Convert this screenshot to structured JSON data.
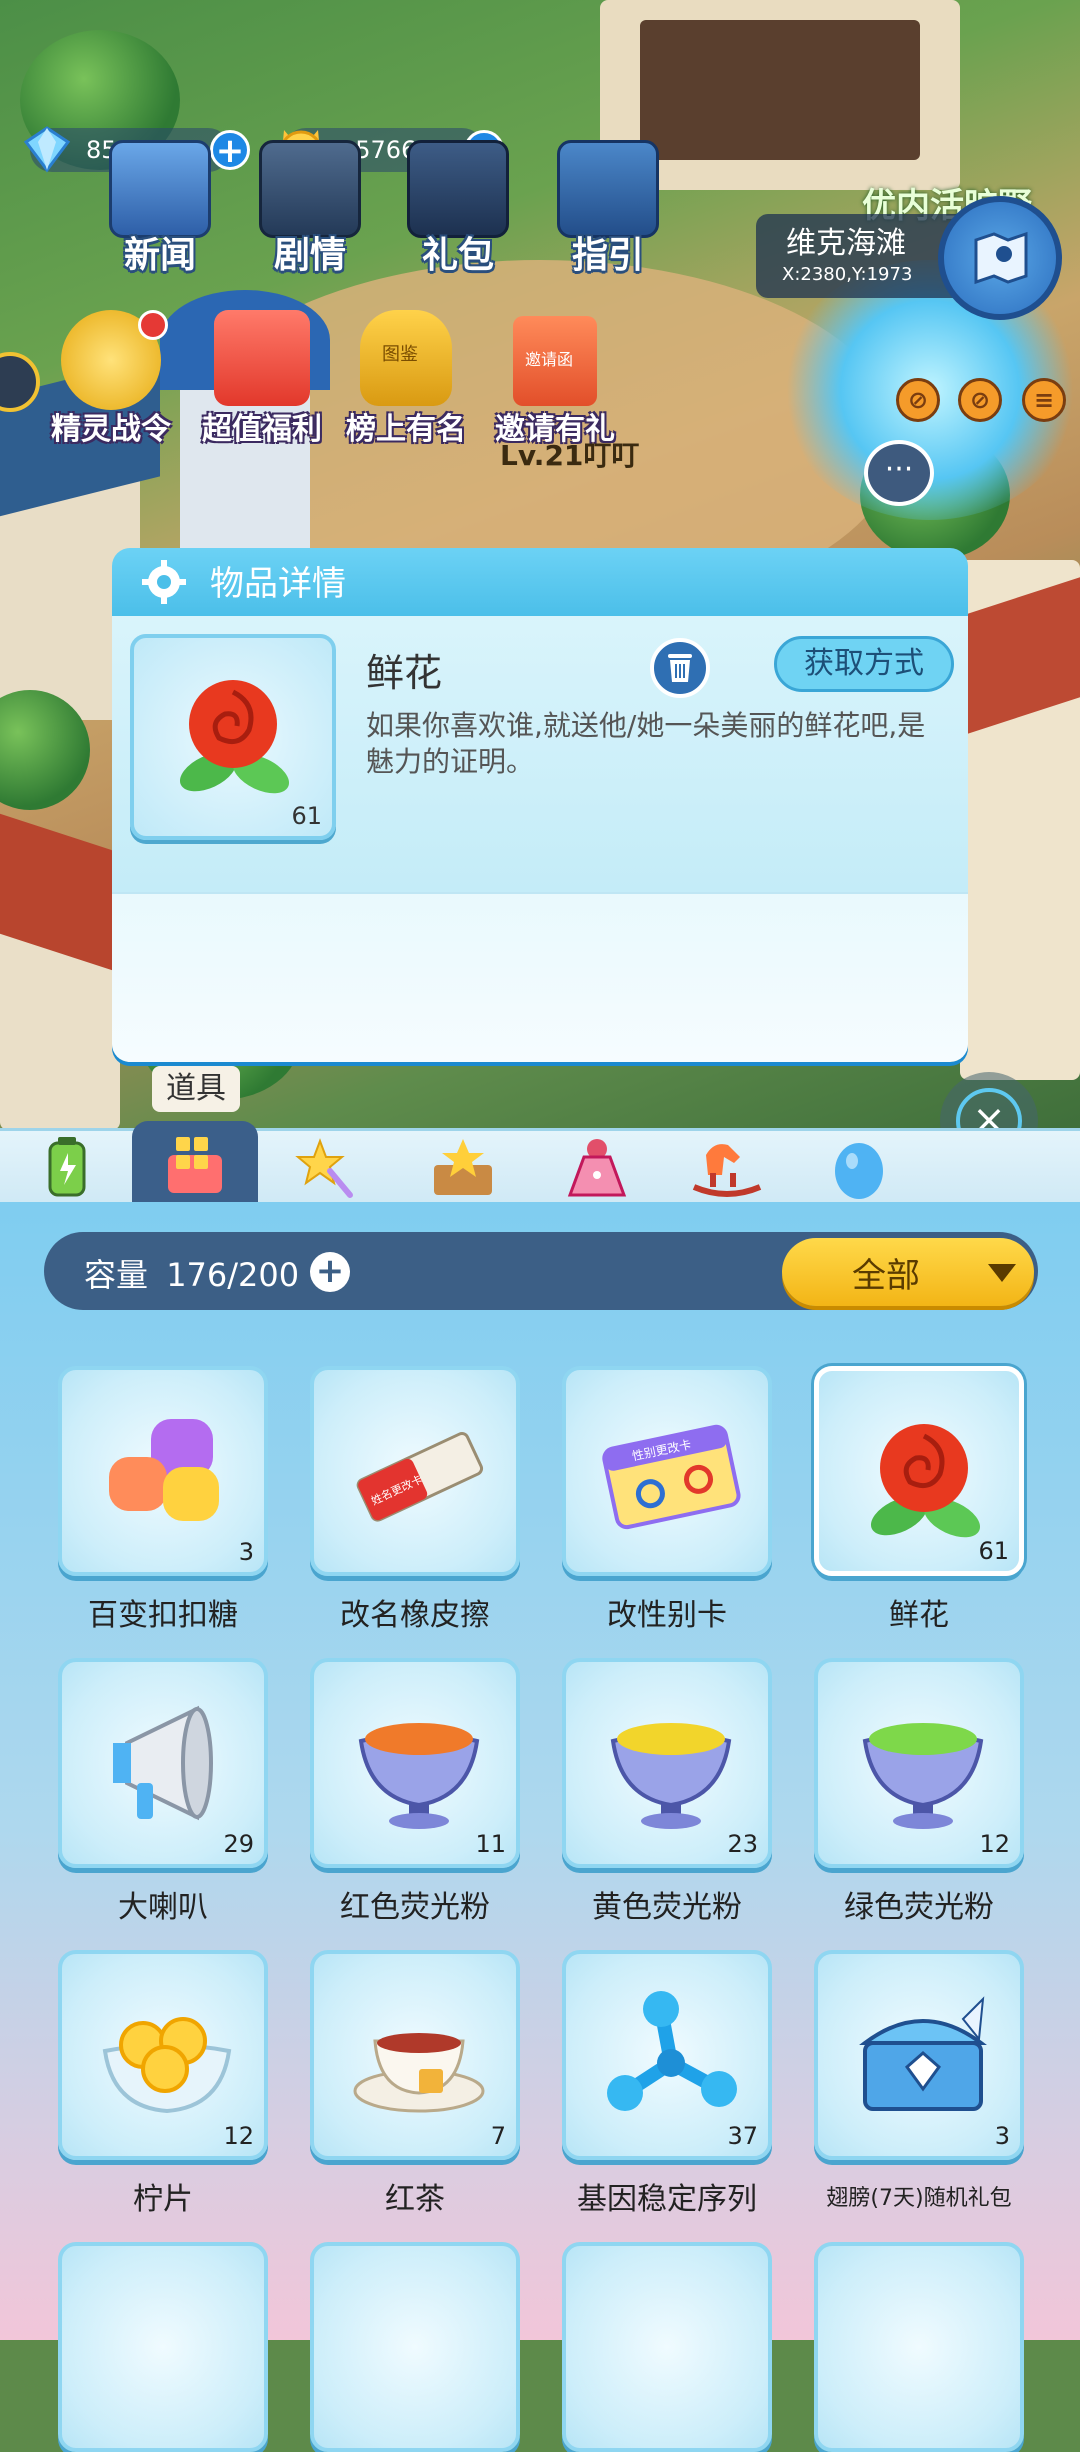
{
  "hud": {
    "diamonds": "859",
    "coins": "1576602",
    "menu": [
      {
        "label": "新闻",
        "icon": "news-icon"
      },
      {
        "label": "剧情",
        "icon": "story-icon"
      },
      {
        "label": "礼包",
        "icon": "gift-pack-icon"
      },
      {
        "label": "指引",
        "icon": "guide-icon"
      }
    ],
    "events": [
      {
        "label": "精灵战令",
        "icon": "battle-pass-icon"
      },
      {
        "label": "超值福利",
        "icon": "welfare-gift-icon"
      },
      {
        "label": "榜上有名",
        "icon": "trophy-icon"
      },
      {
        "label": "邀请有礼",
        "icon": "invite-envelope-icon"
      }
    ],
    "trophy_tag": "图鉴",
    "invite_tag": "邀请函",
    "player_level": "Lv.21叮叮",
    "area_banner": "优内活旷野",
    "location_name": "维克海滩",
    "location_coords": "X:2380,Y:1973"
  },
  "dialog": {
    "title": "物品详情",
    "item_name": "鲜花",
    "item_count": "61",
    "description": "如果你喜欢谁,就送他/她一朵美丽的鲜花吧,是魅力的证明。",
    "obtain_label": "获取方式"
  },
  "inventory": {
    "active_tab_tooltip": "道具",
    "tabs": [
      {
        "icon": "energy-battery-icon"
      },
      {
        "icon": "props-box-icon"
      },
      {
        "icon": "magic-wand-icon"
      },
      {
        "icon": "star-chest-icon"
      },
      {
        "icon": "dress-icon"
      },
      {
        "icon": "rocking-horse-icon"
      },
      {
        "icon": "egg-icon"
      }
    ],
    "capacity_label": "容量",
    "capacity_value": "176/200",
    "filter_label": "全部",
    "items": [
      {
        "name": "百变扣扣糖",
        "count": "3",
        "icon": "gummy-candy-icon"
      },
      {
        "name": "改名橡皮擦",
        "count": "",
        "icon": "eraser-icon",
        "icon_text": "姓名更改卡"
      },
      {
        "name": "改性别卡",
        "count": "",
        "icon": "gender-card-icon",
        "icon_text": "性别更改卡"
      },
      {
        "name": "鲜花",
        "count": "61",
        "icon": "rose-icon",
        "selected": true
      },
      {
        "name": "大喇叭",
        "count": "29",
        "icon": "megaphone-icon"
      },
      {
        "name": "红色荧光粉",
        "count": "11",
        "icon": "red-glow-powder-icon",
        "color": "#f07a2a"
      },
      {
        "name": "黄色荧光粉",
        "count": "23",
        "icon": "yellow-glow-powder-icon",
        "color": "#f2d52b"
      },
      {
        "name": "绿色荧光粉",
        "count": "12",
        "icon": "green-glow-powder-icon",
        "color": "#7ed84a"
      },
      {
        "name": "柠片",
        "count": "12",
        "icon": "lemon-slices-icon"
      },
      {
        "name": "红茶",
        "count": "7",
        "icon": "black-tea-icon"
      },
      {
        "name": "基因稳定序列",
        "count": "37",
        "icon": "gene-molecule-icon"
      },
      {
        "name": "翅膀(7天)随机礼包",
        "count": "3",
        "icon": "treasure-chest-icon"
      }
    ]
  }
}
